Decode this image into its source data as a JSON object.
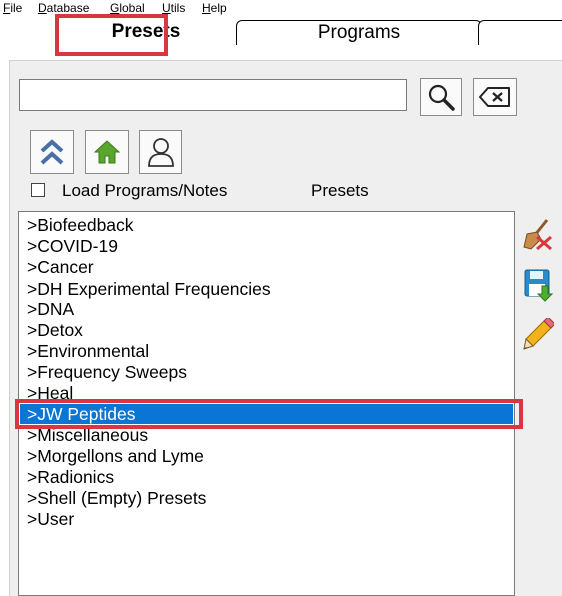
{
  "menubar": {
    "items": [
      {
        "mnemonic": "F",
        "rest": "ile"
      },
      {
        "mnemonic": "D",
        "rest": "atabase"
      },
      {
        "mnemonic": "G",
        "rest": "lobal"
      },
      {
        "mnemonic": "U",
        "rest": "tils"
      },
      {
        "mnemonic": "H",
        "rest": "elp"
      }
    ]
  },
  "tabs": {
    "presets": "Presets",
    "programs": "Programs"
  },
  "search": {
    "value": "",
    "placeholder": ""
  },
  "options": {
    "load_label": "Load Programs/Notes",
    "load_checked": false,
    "section_label": "Presets"
  },
  "list": {
    "items": [
      ">Biofeedback",
      ">COVID-19",
      ">Cancer",
      ">DH Experimental Frequencies",
      ">DNA",
      ">Detox",
      ">Environmental",
      ">Frequency Sweeps",
      ">Heal",
      ">JW Peptides",
      ">Miscellaneous",
      ">Morgellons and Lyme",
      ">Radionics",
      ">Shell (Empty) Presets",
      ">User"
    ],
    "selected_index": 9
  },
  "icons": {
    "search": "magnifier-icon",
    "clear": "backspace-icon",
    "up": "double-chevron-up-icon",
    "home": "home-icon",
    "user": "user-icon",
    "delete": "broom-delete-icon",
    "save": "save-disk-icon",
    "edit": "pencil-icon"
  },
  "colors": {
    "selection": "#0a75d4",
    "highlight_annotation": "#d9363e",
    "panel_bg": "#efefef"
  }
}
